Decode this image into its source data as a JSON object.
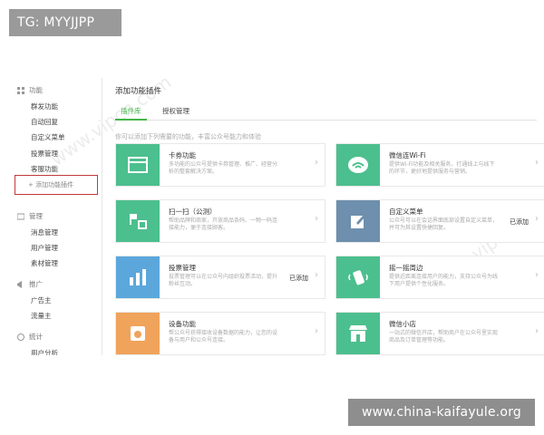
{
  "badges": {
    "tg": "TG: MYYJJPP",
    "domain": "www.china-kaifayule.org"
  },
  "watermark": "www.vipcn.com",
  "sidebar": {
    "groups": [
      {
        "label": "功能",
        "icon": "grid-icon",
        "items": [
          "群发功能",
          "自动回复",
          "自定义菜单",
          "投票管理",
          "客服功能"
        ]
      },
      {
        "label": "管理",
        "icon": "message-icon",
        "items": [
          "消息管理",
          "用户管理",
          "素材管理"
        ]
      },
      {
        "label": "推广",
        "icon": "megaphone-icon",
        "items": [
          "广告主",
          "流量主"
        ]
      },
      {
        "label": "统计",
        "icon": "chart-icon",
        "items": [
          "用户分析"
        ]
      }
    ],
    "add_plugin": "+ 添加功能插件"
  },
  "main": {
    "title": "添加功能插件",
    "tabs": [
      {
        "label": "插件库",
        "active": true
      },
      {
        "label": "授权管理",
        "active": false
      }
    ],
    "hint": "你可以添加下列需要的功能，丰富公众号能力和体验"
  },
  "cards": [
    {
      "title": "卡券功能",
      "desc": "多功能的公众号提供卡券管理、推广、经营分析的整套解决方案。",
      "status": "",
      "color": "#4cbf8e",
      "icon": "card-icon"
    },
    {
      "title": "微信连Wi-Fi",
      "desc": "提供Wi-Fi功能及相关服务，打通线上与线下的环节，更好地提供服务与营销。",
      "status": "",
      "color": "#4cbf8e",
      "icon": "wifi-icon"
    },
    {
      "title": "扫一扫（公测）",
      "desc": "帮助品牌和商家，开放商品条码、一物一码连接能力，便于连接顾客。",
      "status": "",
      "color": "#4cbf8e",
      "icon": "scan-icon"
    },
    {
      "title": "自定义菜单",
      "desc": "公众号可以在会话界面底部设置自定义菜单，并可为其设置快捷回复。",
      "status": "已添加",
      "color": "#6e8fad",
      "icon": "edit-icon"
    },
    {
      "title": "投票管理",
      "desc": "投票管理可以在公众号内组织投票活动，提升粉丝互动。",
      "status": "已添加",
      "color": "#5ba7dc",
      "icon": "bar-chart-icon"
    },
    {
      "title": "摇一摇周边",
      "desc": "提供近距离连接用户的能力，支持公众号为线下用户提供个性化服务。",
      "status": "",
      "color": "#4cbf8e",
      "icon": "shake-icon"
    },
    {
      "title": "设备功能",
      "desc": "帮公众号获得接收设备数据的能力，让您的设备与用户和公众号连接。",
      "status": "",
      "color": "#f0a35a",
      "icon": "device-icon"
    },
    {
      "title": "微信小店",
      "desc": "一站式的微信开店，帮助商户在公众号里实现商品及订单管理等功能。",
      "status": "",
      "color": "#4cbf8e",
      "icon": "shop-icon"
    }
  ]
}
